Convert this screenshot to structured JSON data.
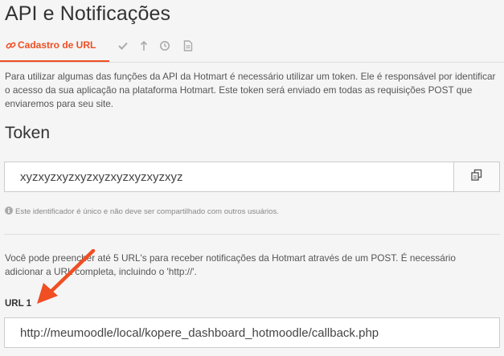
{
  "page": {
    "title": "API e Notificações"
  },
  "tabs": {
    "active": {
      "label": "Cadastro de URL",
      "icon": "link-icon"
    },
    "others": [
      {
        "icon": "check-icon"
      },
      {
        "icon": "upload-icon"
      },
      {
        "icon": "clock-icon"
      },
      {
        "icon": "document-icon"
      }
    ]
  },
  "intro": "Para utilizar algumas das funções da API da Hotmart é necessário utilizar um token. Ele é responsável por identificar o acesso da sua aplicação na plataforma Hotmart. Este token será enviado em todas as requisições POST que enviaremos para seu site.",
  "token": {
    "title": "Token",
    "value": "xyzxyzxyzxyzxyzxyzxyzxyzxyz",
    "copy_icon": "copy-icon",
    "help": "Este identificador é único e não deve ser compartilhado com outros usuários."
  },
  "urls": {
    "description": "Você pode preencher até 5 URL's para receber notificações da Hotmart através de um POST. É necessário adicionar a URL completa, incluindo o 'http://'.",
    "label": "URL 1",
    "value": "http://meumoodle/local/kopere_dashboard_hotmoodle/callback.php"
  },
  "colors": {
    "accent": "#ef4e23",
    "annotation_arrow": "#f04e23"
  }
}
